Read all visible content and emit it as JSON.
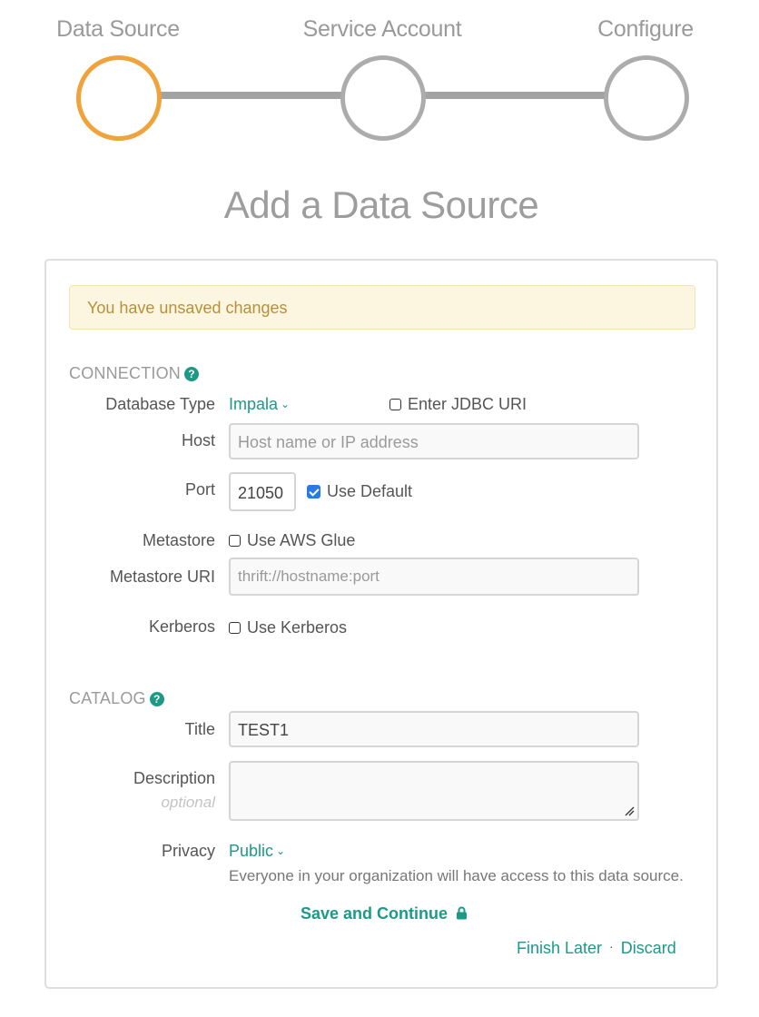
{
  "stepper": {
    "steps": [
      {
        "label": "Data Source",
        "state": "active"
      },
      {
        "label": "Service Account",
        "state": "pending"
      },
      {
        "label": "Configure",
        "state": "pending"
      }
    ],
    "active_color": "#f0a23b",
    "inactive_color": "#acacac"
  },
  "page_title": "Add a Data Source",
  "alert": {
    "text": "You have unsaved changes"
  },
  "connection": {
    "heading": "CONNECTION",
    "help_icon": "question-circle-icon",
    "database_type": {
      "label": "Database Type",
      "value": "Impala"
    },
    "jdbc": {
      "label": "Enter JDBC URI",
      "checked": false
    },
    "host": {
      "label": "Host",
      "value": "",
      "placeholder": "Host name or IP address"
    },
    "port": {
      "label": "Port",
      "value": "21050"
    },
    "use_default": {
      "label": "Use Default",
      "checked": true
    },
    "metastore": {
      "label": "Metastore",
      "option_label": "Use AWS Glue",
      "checked": false
    },
    "metastore_uri": {
      "label": "Metastore URI",
      "value": "",
      "placeholder": "thrift://hostname:port"
    },
    "kerberos": {
      "label": "Kerberos",
      "option_label": "Use Kerberos",
      "checked": false
    }
  },
  "catalog": {
    "heading": "CATALOG",
    "help_icon": "question-circle-icon",
    "title": {
      "label": "Title",
      "value": "TEST1"
    },
    "description": {
      "label": "Description",
      "sublabel": "optional",
      "value": ""
    },
    "privacy": {
      "label": "Privacy",
      "value": "Public",
      "note": "Everyone in your organization will have access to this data source."
    }
  },
  "actions": {
    "save_label": "Save and Continue",
    "save_icon": "lock-icon",
    "finish_later": "Finish Later",
    "separator": "·",
    "discard": "Discard"
  },
  "colors": {
    "accent": "#1c9a86",
    "alert_bg": "#fcf6e1",
    "alert_text": "#b7903c",
    "checkbox_checked": "#2a7ae2"
  }
}
